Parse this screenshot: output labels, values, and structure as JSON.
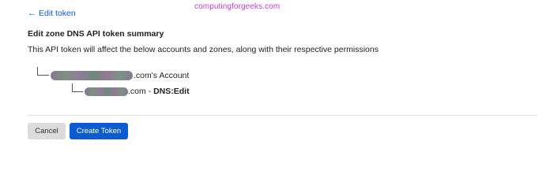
{
  "watermark": "computingforgeeks.com",
  "nav": {
    "back_arrow": "←",
    "back_label": "Edit token"
  },
  "summary": {
    "title": "Edit zone DNS API token summary",
    "description": "This API token will affect the below accounts and zones, along with their respective permissions"
  },
  "tree": {
    "account_suffix": ".com's Account",
    "zone_suffix": ".com - ",
    "zone_permission": "DNS:Edit"
  },
  "actions": {
    "cancel_label": "Cancel",
    "create_label": "Create Token"
  },
  "colors": {
    "link": "#0b5ad9",
    "primary_button": "#0b5bd3",
    "cancel_button": "#dcdcdc",
    "watermark": "#c73bd6"
  }
}
